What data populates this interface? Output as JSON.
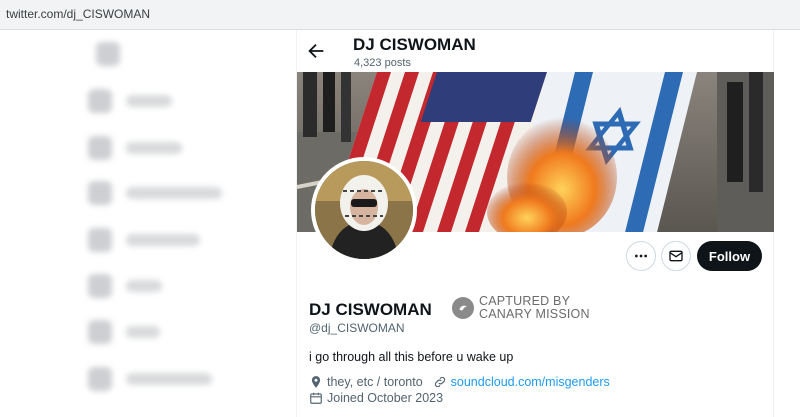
{
  "browser": {
    "url": "twitter.com/dj_CISWOMAN"
  },
  "header": {
    "title": "DJ CISWOMAN",
    "post_count": "4,323 posts"
  },
  "actions": {
    "follow_label": "Follow"
  },
  "profile": {
    "display_name": "DJ CISWOMAN",
    "handle": "@dj_CISWOMAN",
    "bio": "i go through all this before u wake up",
    "location": "they, etc / toronto",
    "website": "soundcloud.com/misgenders",
    "joined": "Joined October 2023"
  },
  "watermark": {
    "line1": "CAPTURED BY",
    "line2": "CANARY MISSION"
  },
  "colors": {
    "accent": "#1d9bf0",
    "follow_bg": "#0f1419",
    "secondary_text": "#536471"
  },
  "icons": [
    "back-arrow-icon",
    "more-icon",
    "mail-icon",
    "location-icon",
    "link-icon",
    "calendar-icon",
    "canary-badge-icon"
  ]
}
